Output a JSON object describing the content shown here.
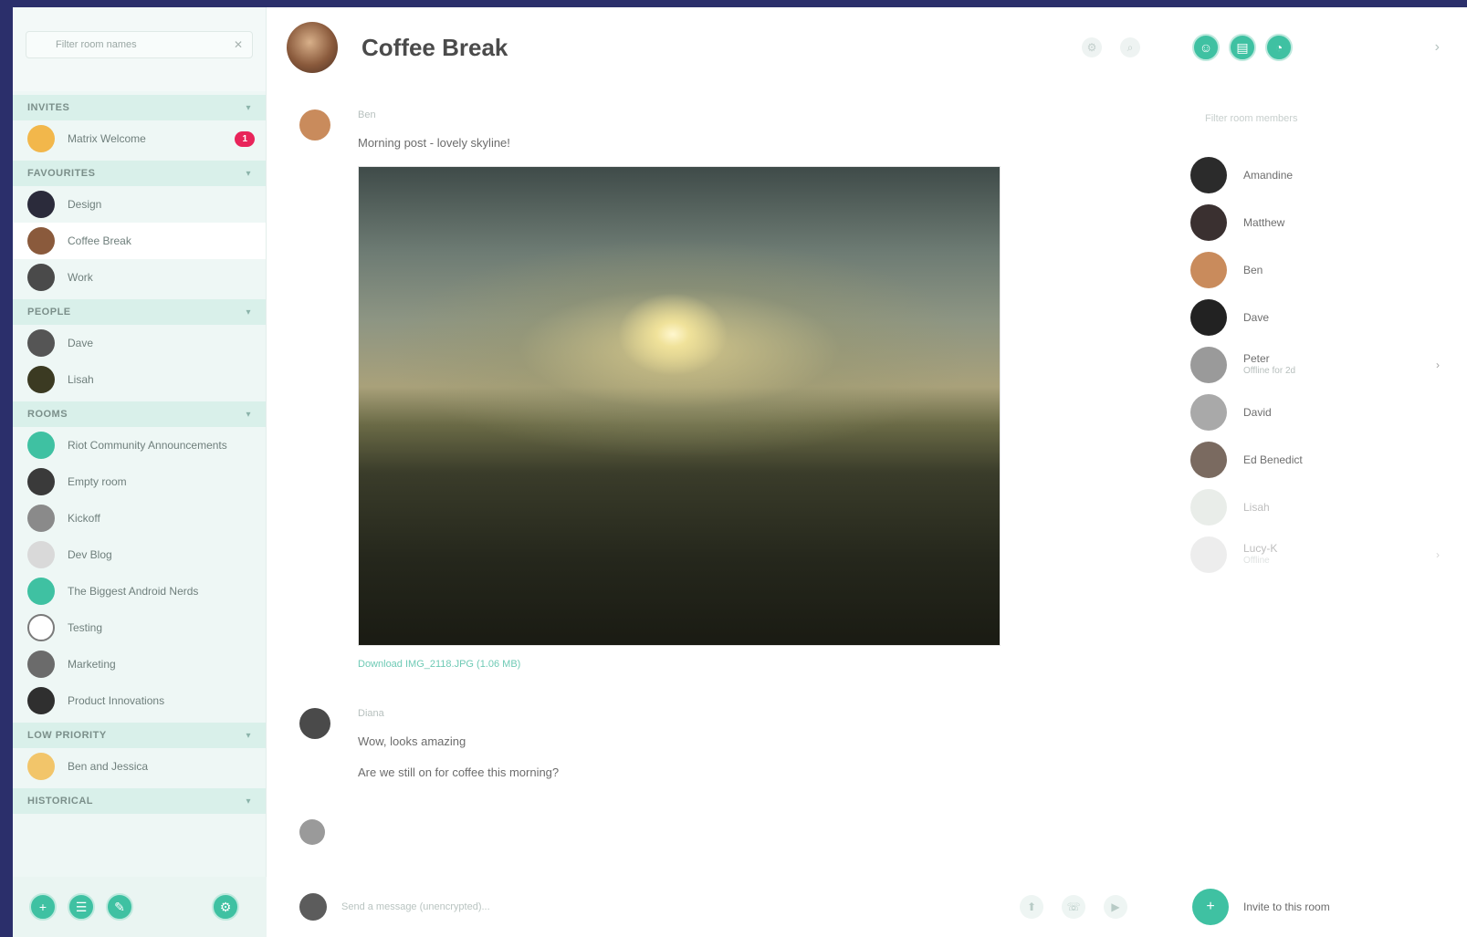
{
  "sidebar": {
    "search_placeholder": "Filter room names",
    "sections": [
      {
        "title": "INVITES",
        "items": [
          {
            "label": "Matrix Welcome",
            "badge": "1",
            "color": "#f2b74b"
          }
        ]
      },
      {
        "title": "FAVOURITES",
        "items": [
          {
            "label": "Design",
            "color": "#2b2b3b"
          },
          {
            "label": "Coffee Break",
            "color": "#8a5a3c",
            "active": true
          },
          {
            "label": "Work",
            "color": "#4a4a4a"
          }
        ]
      },
      {
        "title": "PEOPLE",
        "items": [
          {
            "label": "Dave",
            "color": "#555555"
          },
          {
            "label": "Lisah",
            "color": "#3b3a22"
          }
        ]
      },
      {
        "title": "ROOMS",
        "items": [
          {
            "label": "Riot Community Announcements",
            "color": "#3fc1a2"
          },
          {
            "label": "Empty room",
            "color": "#3a3a3a"
          },
          {
            "label": "Kickoff",
            "color": "#8a8a8a"
          },
          {
            "label": "Dev Blog",
            "color": "#d9d9d9"
          },
          {
            "label": "The Biggest Android Nerds",
            "color": "#3fc1a2"
          },
          {
            "label": "Testing",
            "color": "#ffffff"
          },
          {
            "label": "Marketing",
            "color": "#6b6b6b"
          },
          {
            "label": "Product Innovations",
            "color": "#2f2f2f"
          }
        ]
      },
      {
        "title": "LOW PRIORITY",
        "items": [
          {
            "label": "Ben and Jessica",
            "color": "#f2c56a"
          }
        ]
      },
      {
        "title": "HISTORICAL",
        "items": []
      }
    ]
  },
  "main": {
    "room_title": "Coffee Break",
    "messages": [
      {
        "sender": "Ben",
        "text": "Morning post - lovely skyline!",
        "avatar_color": "#c98b5c",
        "image": true,
        "file_label": "Download IMG_2118.JPG (1.06 MB)"
      },
      {
        "sender": "Diana",
        "lines": [
          "Wow, looks amazing",
          "Are we still on for coffee this morning?"
        ],
        "avatar_color": "#4a4a4a"
      }
    ],
    "composer_placeholder": "Send a message (unencrypted)..."
  },
  "right_panel": {
    "filter_placeholder": "Filter room members",
    "members": [
      {
        "name": "Amandine",
        "color": "#2b2b2b"
      },
      {
        "name": "Matthew",
        "color": "#3a3030"
      },
      {
        "name": "Ben",
        "color": "#c98b5c"
      },
      {
        "name": "Dave",
        "color": "#222222"
      },
      {
        "name": "Peter",
        "sub": "Offline for 2d",
        "color": "#9a9a9a",
        "arrow": "›"
      },
      {
        "name": "David",
        "color": "#a9a9a9"
      },
      {
        "name": "Ed Benedict",
        "color": "#7a6a60"
      },
      {
        "name": "Lisah",
        "color": "#cfd9cf",
        "faded": true
      },
      {
        "name": "Lucy-K",
        "sub": "Offline",
        "color": "#d8d8d8",
        "faded": true,
        "arrow": "›"
      }
    ],
    "invite_label": "Invite to this room"
  }
}
